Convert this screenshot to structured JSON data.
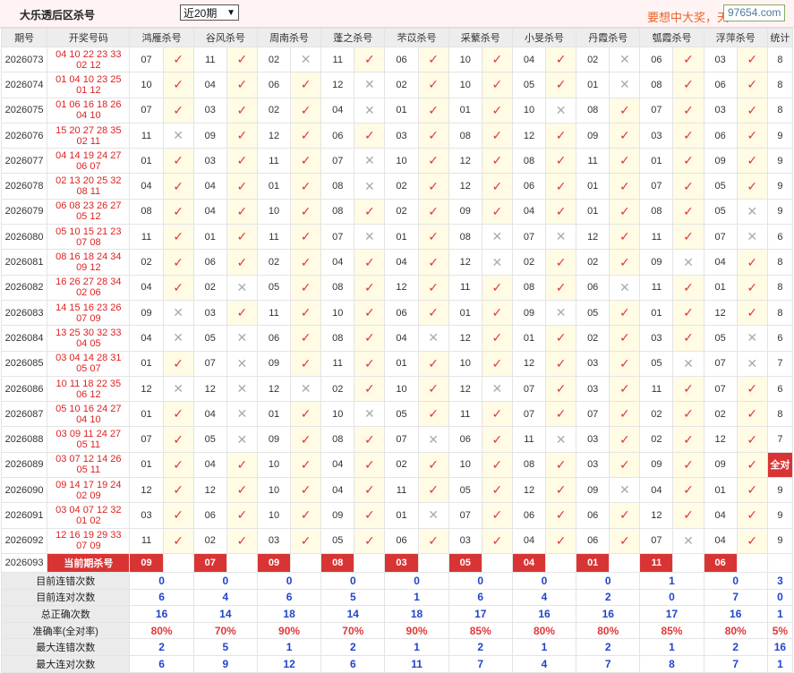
{
  "header": {
    "title": "大乐透后区杀号",
    "period_select": "近20期",
    "marquee": "要想中大奖，天",
    "logo": "97654.com"
  },
  "columns": [
    "期号",
    "开奖号码",
    "鸿雁杀号",
    "谷风杀号",
    "周南杀号",
    "蓬之杀号",
    "芣苡杀号",
    "采蘩杀号",
    "小旻杀号",
    "丹霞杀号",
    "瓠霞杀号",
    "浮萍杀号",
    "统计"
  ],
  "rows": [
    {
      "p": "2026073",
      "l1": "04 10 22 23 33",
      "l2": "02 12",
      "k": [
        [
          "07",
          1
        ],
        [
          "11",
          1
        ],
        [
          "02",
          0
        ],
        [
          "11",
          1
        ],
        [
          "06",
          1
        ],
        [
          "10",
          1
        ],
        [
          "04",
          1
        ],
        [
          "02",
          0
        ],
        [
          "06",
          1
        ],
        [
          "03",
          1
        ]
      ],
      "s": "8"
    },
    {
      "p": "2026074",
      "l1": "01 04 10 23 25",
      "l2": "01 12",
      "k": [
        [
          "10",
          1
        ],
        [
          "04",
          1
        ],
        [
          "06",
          1
        ],
        [
          "12",
          0
        ],
        [
          "02",
          1
        ],
        [
          "10",
          1
        ],
        [
          "05",
          1
        ],
        [
          "01",
          0
        ],
        [
          "08",
          1
        ],
        [
          "06",
          1
        ]
      ],
      "s": "8"
    },
    {
      "p": "2026075",
      "l1": "01 06 16 18 26",
      "l2": "04 10",
      "k": [
        [
          "07",
          1
        ],
        [
          "03",
          1
        ],
        [
          "02",
          1
        ],
        [
          "04",
          0
        ],
        [
          "01",
          1
        ],
        [
          "01",
          1
        ],
        [
          "10",
          0
        ],
        [
          "08",
          1
        ],
        [
          "07",
          1
        ],
        [
          "03",
          1
        ]
      ],
      "s": "8"
    },
    {
      "p": "2026076",
      "l1": "15 20 27 28 35",
      "l2": "02 11",
      "k": [
        [
          "11",
          0
        ],
        [
          "09",
          1
        ],
        [
          "12",
          1
        ],
        [
          "06",
          1
        ],
        [
          "03",
          1
        ],
        [
          "08",
          1
        ],
        [
          "12",
          1
        ],
        [
          "09",
          1
        ],
        [
          "03",
          1
        ],
        [
          "06",
          1
        ]
      ],
      "s": "9"
    },
    {
      "p": "2026077",
      "l1": "04 14 19 24 27",
      "l2": "06 07",
      "k": [
        [
          "01",
          1
        ],
        [
          "03",
          1
        ],
        [
          "11",
          1
        ],
        [
          "07",
          0
        ],
        [
          "10",
          1
        ],
        [
          "12",
          1
        ],
        [
          "08",
          1
        ],
        [
          "11",
          1
        ],
        [
          "01",
          1
        ],
        [
          "09",
          1
        ]
      ],
      "s": "9"
    },
    {
      "p": "2026078",
      "l1": "02 13 20 25 32",
      "l2": "08 11",
      "k": [
        [
          "04",
          1
        ],
        [
          "04",
          1
        ],
        [
          "01",
          1
        ],
        [
          "08",
          0
        ],
        [
          "02",
          1
        ],
        [
          "12",
          1
        ],
        [
          "06",
          1
        ],
        [
          "01",
          1
        ],
        [
          "07",
          1
        ],
        [
          "05",
          1
        ]
      ],
      "s": "9"
    },
    {
      "p": "2026079",
      "l1": "06 08 23 26 27",
      "l2": "05 12",
      "k": [
        [
          "08",
          1
        ],
        [
          "04",
          1
        ],
        [
          "10",
          1
        ],
        [
          "08",
          1
        ],
        [
          "02",
          1
        ],
        [
          "09",
          1
        ],
        [
          "04",
          1
        ],
        [
          "01",
          1
        ],
        [
          "08",
          1
        ],
        [
          "05",
          0
        ]
      ],
      "s": "9"
    },
    {
      "p": "2026080",
      "l1": "05 10 15 21 23",
      "l2": "07 08",
      "k": [
        [
          "11",
          1
        ],
        [
          "01",
          1
        ],
        [
          "11",
          1
        ],
        [
          "07",
          0
        ],
        [
          "01",
          1
        ],
        [
          "08",
          0
        ],
        [
          "07",
          0
        ],
        [
          "12",
          1
        ],
        [
          "11",
          1
        ],
        [
          "07",
          0
        ]
      ],
      "s": "6"
    },
    {
      "p": "2026081",
      "l1": "08 16 18 24 34",
      "l2": "09 12",
      "k": [
        [
          "02",
          1
        ],
        [
          "06",
          1
        ],
        [
          "02",
          1
        ],
        [
          "04",
          1
        ],
        [
          "04",
          1
        ],
        [
          "12",
          0
        ],
        [
          "02",
          1
        ],
        [
          "02",
          1
        ],
        [
          "09",
          0
        ],
        [
          "04",
          1
        ]
      ],
      "s": "8"
    },
    {
      "p": "2026082",
      "l1": "16 26 27 28 34",
      "l2": "02 06",
      "k": [
        [
          "04",
          1
        ],
        [
          "02",
          0
        ],
        [
          "05",
          1
        ],
        [
          "08",
          1
        ],
        [
          "12",
          1
        ],
        [
          "11",
          1
        ],
        [
          "08",
          1
        ],
        [
          "06",
          0
        ],
        [
          "11",
          1
        ],
        [
          "01",
          1
        ]
      ],
      "s": "8"
    },
    {
      "p": "2026083",
      "l1": "14 15 16 23 26",
      "l2": "07 09",
      "k": [
        [
          "09",
          0
        ],
        [
          "03",
          1
        ],
        [
          "11",
          1
        ],
        [
          "10",
          1
        ],
        [
          "06",
          1
        ],
        [
          "01",
          1
        ],
        [
          "09",
          0
        ],
        [
          "05",
          1
        ],
        [
          "01",
          1
        ],
        [
          "12",
          1
        ]
      ],
      "s": "8"
    },
    {
      "p": "2026084",
      "l1": "13 25 30 32 33",
      "l2": "04 05",
      "k": [
        [
          "04",
          0
        ],
        [
          "05",
          0
        ],
        [
          "06",
          1
        ],
        [
          "08",
          1
        ],
        [
          "04",
          0
        ],
        [
          "12",
          1
        ],
        [
          "01",
          1
        ],
        [
          "02",
          1
        ],
        [
          "03",
          1
        ],
        [
          "05",
          0
        ]
      ],
      "s": "6"
    },
    {
      "p": "2026085",
      "l1": "03 04 14 28 31",
      "l2": "05 07",
      "k": [
        [
          "01",
          1
        ],
        [
          "07",
          0
        ],
        [
          "09",
          1
        ],
        [
          "11",
          1
        ],
        [
          "01",
          1
        ],
        [
          "10",
          1
        ],
        [
          "12",
          1
        ],
        [
          "03",
          1
        ],
        [
          "05",
          0
        ],
        [
          "07",
          0
        ]
      ],
      "s": "7"
    },
    {
      "p": "2026086",
      "l1": "10 11 18 22 35",
      "l2": "06 12",
      "k": [
        [
          "12",
          0
        ],
        [
          "12",
          0
        ],
        [
          "12",
          0
        ],
        [
          "02",
          1
        ],
        [
          "10",
          1
        ],
        [
          "12",
          0
        ],
        [
          "07",
          1
        ],
        [
          "03",
          1
        ],
        [
          "11",
          1
        ],
        [
          "07",
          1
        ]
      ],
      "s": "6"
    },
    {
      "p": "2026087",
      "l1": "05 10 16 24 27",
      "l2": "04 10",
      "k": [
        [
          "01",
          1
        ],
        [
          "04",
          0
        ],
        [
          "01",
          1
        ],
        [
          "10",
          0
        ],
        [
          "05",
          1
        ],
        [
          "11",
          1
        ],
        [
          "07",
          1
        ],
        [
          "07",
          1
        ],
        [
          "02",
          1
        ],
        [
          "02",
          1
        ]
      ],
      "s": "8"
    },
    {
      "p": "2026088",
      "l1": "03 09 11 24 27",
      "l2": "05 11",
      "k": [
        [
          "07",
          1
        ],
        [
          "05",
          0
        ],
        [
          "09",
          1
        ],
        [
          "08",
          1
        ],
        [
          "07",
          0
        ],
        [
          "06",
          1
        ],
        [
          "11",
          0
        ],
        [
          "03",
          1
        ],
        [
          "02",
          1
        ],
        [
          "12",
          1
        ]
      ],
      "s": "7"
    },
    {
      "p": "2026089",
      "l1": "03 07 12 14 26",
      "l2": "05 11",
      "k": [
        [
          "01",
          1
        ],
        [
          "04",
          1
        ],
        [
          "10",
          1
        ],
        [
          "04",
          1
        ],
        [
          "02",
          1
        ],
        [
          "10",
          1
        ],
        [
          "08",
          1
        ],
        [
          "03",
          1
        ],
        [
          "09",
          1
        ],
        [
          "09",
          1
        ]
      ],
      "s": "全对",
      "badge": true
    },
    {
      "p": "2026090",
      "l1": "09 14 17 19 24",
      "l2": "02 09",
      "k": [
        [
          "12",
          1
        ],
        [
          "12",
          1
        ],
        [
          "10",
          1
        ],
        [
          "04",
          1
        ],
        [
          "11",
          1
        ],
        [
          "05",
          1
        ],
        [
          "12",
          1
        ],
        [
          "09",
          0
        ],
        [
          "04",
          1
        ],
        [
          "01",
          1
        ]
      ],
      "s": "9"
    },
    {
      "p": "2026091",
      "l1": "03 04 07 12 32",
      "l2": "01 02",
      "k": [
        [
          "03",
          1
        ],
        [
          "06",
          1
        ],
        [
          "10",
          1
        ],
        [
          "09",
          1
        ],
        [
          "01",
          0
        ],
        [
          "07",
          1
        ],
        [
          "06",
          1
        ],
        [
          "06",
          1
        ],
        [
          "12",
          1
        ],
        [
          "04",
          1
        ]
      ],
      "s": "9"
    },
    {
      "p": "2026092",
      "l1": "12 16 19 29 33",
      "l2": "07 09",
      "k": [
        [
          "11",
          1
        ],
        [
          "02",
          1
        ],
        [
          "03",
          1
        ],
        [
          "05",
          1
        ],
        [
          "06",
          1
        ],
        [
          "03",
          1
        ],
        [
          "04",
          1
        ],
        [
          "06",
          1
        ],
        [
          "07",
          0
        ],
        [
          "04",
          1
        ]
      ],
      "s": "9"
    }
  ],
  "current": {
    "period": "2026093",
    "label": "当前期杀号",
    "kills": [
      "09",
      "07",
      "09",
      "08",
      "03",
      "05",
      "04",
      "01",
      "11",
      "06"
    ]
  },
  "stats": [
    {
      "label": "目前连错次数",
      "v": [
        "0",
        "0",
        "0",
        "0",
        "0",
        "0",
        "0",
        "0",
        "1",
        "0",
        "3"
      ]
    },
    {
      "label": "目前连对次数",
      "v": [
        "6",
        "4",
        "6",
        "5",
        "1",
        "6",
        "4",
        "2",
        "0",
        "7",
        "0"
      ]
    },
    {
      "label": "总正确次数",
      "v": [
        "16",
        "14",
        "18",
        "14",
        "18",
        "17",
        "16",
        "16",
        "17",
        "16",
        "1"
      ]
    },
    {
      "label": "准确率(全对率)",
      "v": [
        "80%",
        "70%",
        "90%",
        "70%",
        "90%",
        "85%",
        "80%",
        "80%",
        "85%",
        "80%",
        "5%"
      ],
      "red": true
    },
    {
      "label": "最大连错次数",
      "v": [
        "2",
        "5",
        "1",
        "2",
        "1",
        "2",
        "1",
        "2",
        "1",
        "2",
        "16"
      ]
    },
    {
      "label": "最大连对次数",
      "v": [
        "6",
        "9",
        "12",
        "6",
        "11",
        "7",
        "4",
        "7",
        "8",
        "7",
        "1"
      ]
    }
  ],
  "marks": {
    "ok": "✓",
    "no": "✕"
  }
}
